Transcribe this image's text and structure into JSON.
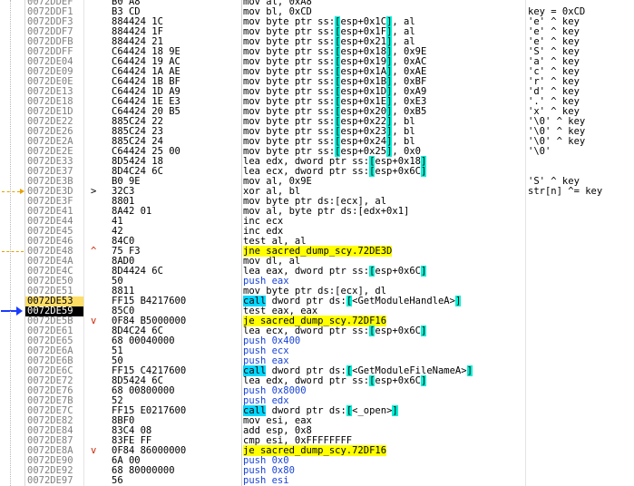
{
  "rows": [
    {
      "addr": "0072DDEF",
      "bytes": "B0 A8",
      "mark": "",
      "parts": [
        {
          "t": "mov al, 0xA8",
          "k": "m"
        }
      ],
      "comment": ""
    },
    {
      "addr": "0072DDF1",
      "bytes": "B3 CD",
      "mark": "",
      "parts": [
        {
          "t": "mov bl, 0xCD",
          "k": "m"
        }
      ],
      "comment": "key = 0xCD"
    },
    {
      "addr": "0072DDF3",
      "bytes": "884424 1C",
      "mark": "",
      "parts": [
        {
          "t": "mov byte ptr ss:",
          "k": "m"
        },
        {
          "t": "[esp+0x1C]",
          "k": "br"
        },
        {
          "t": ", al",
          "k": "m"
        }
      ],
      "comment": "'e' ^ key"
    },
    {
      "addr": "0072DDF7",
      "bytes": "884424 1F",
      "mark": "",
      "parts": [
        {
          "t": "mov byte ptr ss:",
          "k": "m"
        },
        {
          "t": "[esp+0x1F]",
          "k": "br"
        },
        {
          "t": ", al",
          "k": "m"
        }
      ],
      "comment": "'e' ^ key"
    },
    {
      "addr": "0072DDFB",
      "bytes": "884424 21",
      "mark": "",
      "parts": [
        {
          "t": "mov byte ptr ss:",
          "k": "m"
        },
        {
          "t": "[esp+0x21]",
          "k": "br"
        },
        {
          "t": ", al",
          "k": "m"
        }
      ],
      "comment": "'e' ^ key"
    },
    {
      "addr": "0072DDFF",
      "bytes": "C64424 18 9E",
      "mark": "",
      "parts": [
        {
          "t": "mov byte ptr ss:",
          "k": "m"
        },
        {
          "t": "[esp+0x18]",
          "k": "br"
        },
        {
          "t": ", 0x9E",
          "k": "m"
        }
      ],
      "comment": "'S' ^ key"
    },
    {
      "addr": "0072DE04",
      "bytes": "C64424 19 AC",
      "mark": "",
      "parts": [
        {
          "t": "mov byte ptr ss:",
          "k": "m"
        },
        {
          "t": "[esp+0x19]",
          "k": "br"
        },
        {
          "t": ", 0xAC",
          "k": "m"
        }
      ],
      "comment": "'a' ^ key"
    },
    {
      "addr": "0072DE09",
      "bytes": "C64424 1A AE",
      "mark": "",
      "parts": [
        {
          "t": "mov byte ptr ss:",
          "k": "m"
        },
        {
          "t": "[esp+0x1A]",
          "k": "br"
        },
        {
          "t": ", 0xAE",
          "k": "m"
        }
      ],
      "comment": "'c' ^ key"
    },
    {
      "addr": "0072DE0E",
      "bytes": "C64424 1B BF",
      "mark": "",
      "parts": [
        {
          "t": "mov byte ptr ss:",
          "k": "m"
        },
        {
          "t": "[esp+0x1B]",
          "k": "br"
        },
        {
          "t": ", 0xBF",
          "k": "m"
        }
      ],
      "comment": "'r' ^ key"
    },
    {
      "addr": "0072DE13",
      "bytes": "C64424 1D A9",
      "mark": "",
      "parts": [
        {
          "t": "mov byte ptr ss:",
          "k": "m"
        },
        {
          "t": "[esp+0x1D]",
          "k": "br"
        },
        {
          "t": ", 0xA9",
          "k": "m"
        }
      ],
      "comment": "'d' ^ key"
    },
    {
      "addr": "0072DE18",
      "bytes": "C64424 1E E3",
      "mark": "",
      "parts": [
        {
          "t": "mov byte ptr ss:",
          "k": "m"
        },
        {
          "t": "[esp+0x1E]",
          "k": "br"
        },
        {
          "t": ", 0xE3",
          "k": "m"
        }
      ],
      "comment": "'.' ^ key"
    },
    {
      "addr": "0072DE1D",
      "bytes": "C64424 20 B5",
      "mark": "",
      "parts": [
        {
          "t": "mov byte ptr ss:",
          "k": "m"
        },
        {
          "t": "[esp+0x20]",
          "k": "br"
        },
        {
          "t": ", 0xB5",
          "k": "m"
        }
      ],
      "comment": "'x' ^ key"
    },
    {
      "addr": "0072DE22",
      "bytes": "885C24 22",
      "mark": "",
      "parts": [
        {
          "t": "mov byte ptr ss:",
          "k": "m"
        },
        {
          "t": "[esp+0x22]",
          "k": "br"
        },
        {
          "t": ", bl",
          "k": "m"
        }
      ],
      "comment": "'\\0' ^ key"
    },
    {
      "addr": "0072DE26",
      "bytes": "885C24 23",
      "mark": "",
      "parts": [
        {
          "t": "mov byte ptr ss:",
          "k": "m"
        },
        {
          "t": "[esp+0x23]",
          "k": "br"
        },
        {
          "t": ", bl",
          "k": "m"
        }
      ],
      "comment": "'\\0' ^ key"
    },
    {
      "addr": "0072DE2A",
      "bytes": "885C24 24",
      "mark": "",
      "parts": [
        {
          "t": "mov byte ptr ss:",
          "k": "m"
        },
        {
          "t": "[esp+0x24]",
          "k": "br"
        },
        {
          "t": ", bl",
          "k": "m"
        }
      ],
      "comment": "'\\0' ^ key"
    },
    {
      "addr": "0072DE2E",
      "bytes": "C64424 25 00",
      "mark": "",
      "parts": [
        {
          "t": "mov byte ptr ss:",
          "k": "m"
        },
        {
          "t": "[esp+0x25]",
          "k": "br"
        },
        {
          "t": ", 0x0",
          "k": "m"
        }
      ],
      "comment": "'\\0'"
    },
    {
      "addr": "0072DE33",
      "bytes": "8D5424 18",
      "mark": "",
      "parts": [
        {
          "t": "lea edx, dword ptr ss:",
          "k": "m"
        },
        {
          "t": "[esp+0x18]",
          "k": "br"
        }
      ],
      "comment": ""
    },
    {
      "addr": "0072DE37",
      "bytes": "8D4C24 6C",
      "mark": "",
      "parts": [
        {
          "t": "lea ecx, dword ptr ss:",
          "k": "m"
        },
        {
          "t": "[esp+0x6C]",
          "k": "br"
        }
      ],
      "comment": ""
    },
    {
      "addr": "0072DE3B",
      "bytes": "B0 9E",
      "mark": "",
      "parts": [
        {
          "t": "mov al, 0x9E",
          "k": "m"
        }
      ],
      "comment": "'S' ^ key"
    },
    {
      "addr": "0072DE3D",
      "bytes": "32C3",
      "mark": ">",
      "parts": [
        {
          "t": "xor al, bl",
          "k": "m"
        }
      ],
      "comment": "str[n] ^= key"
    },
    {
      "addr": "0072DE3F",
      "bytes": "8801",
      "mark": "",
      "parts": [
        {
          "t": "mov byte ptr ds:",
          "k": "m"
        },
        {
          "t": "[ecx]",
          "k": "m"
        },
        {
          "t": ", al",
          "k": "m"
        }
      ],
      "comment": ""
    },
    {
      "addr": "0072DE41",
      "bytes": "8A42 01",
      "mark": "",
      "parts": [
        {
          "t": "mov al, byte ptr ds:",
          "k": "m"
        },
        {
          "t": "[edx+0x1]",
          "k": "m"
        }
      ],
      "comment": ""
    },
    {
      "addr": "0072DE44",
      "bytes": "41",
      "mark": "",
      "parts": [
        {
          "t": "inc ecx",
          "k": "m"
        }
      ],
      "comment": ""
    },
    {
      "addr": "0072DE45",
      "bytes": "42",
      "mark": "",
      "parts": [
        {
          "t": "inc edx",
          "k": "m"
        }
      ],
      "comment": ""
    },
    {
      "addr": "0072DE46",
      "bytes": "84C0",
      "mark": "",
      "parts": [
        {
          "t": "test al, al",
          "k": "m"
        }
      ],
      "comment": ""
    },
    {
      "addr": "0072DE48",
      "bytes": "75 F3",
      "mark": "^",
      "parts": [
        {
          "t": "jne sacred_dump_scy.72DE3D",
          "k": "jcc"
        }
      ],
      "comment": ""
    },
    {
      "addr": "0072DE4A",
      "bytes": "8AD0",
      "mark": "",
      "parts": [
        {
          "t": "mov dl, al",
          "k": "m"
        }
      ],
      "comment": ""
    },
    {
      "addr": "0072DE4C",
      "bytes": "8D4424 6C",
      "mark": "",
      "parts": [
        {
          "t": "lea eax, dword ptr ss:",
          "k": "m"
        },
        {
          "t": "[esp+0x6C]",
          "k": "br"
        }
      ],
      "comment": ""
    },
    {
      "addr": "0072DE50",
      "bytes": "50",
      "mark": "",
      "parts": [
        {
          "t": "push eax",
          "k": "push"
        }
      ],
      "comment": ""
    },
    {
      "addr": "0072DE51",
      "bytes": "8811",
      "mark": "",
      "parts": [
        {
          "t": "mov byte ptr ds:",
          "k": "m"
        },
        {
          "t": "[ecx]",
          "k": "m"
        },
        {
          "t": ", dl",
          "k": "m"
        }
      ],
      "comment": ""
    },
    {
      "addr": "0072DE53",
      "bytes": "FF15 B4217600",
      "mark": "",
      "parts": [
        {
          "t": "call",
          "k": "call"
        },
        {
          "t": " dword ptr ds:",
          "k": "m"
        },
        {
          "t": "[<GetModuleHandleA>]",
          "k": "br"
        }
      ],
      "comment": "",
      "state": "hl"
    },
    {
      "addr": "0072DE59",
      "bytes": "85C0",
      "mark": "",
      "parts": [
        {
          "t": "test eax, eax",
          "k": "m"
        }
      ],
      "comment": "",
      "state": "cur"
    },
    {
      "addr": "0072DE5B",
      "bytes": "0F84 B5000000",
      "mark": "v",
      "parts": [
        {
          "t": "je sacred_dump_scy.72DF16",
          "k": "jcc"
        }
      ],
      "comment": ""
    },
    {
      "addr": "0072DE61",
      "bytes": "8D4C24 6C",
      "mark": "",
      "parts": [
        {
          "t": "lea ecx, dword ptr ss:",
          "k": "m"
        },
        {
          "t": "[esp+0x6C]",
          "k": "br"
        }
      ],
      "comment": ""
    },
    {
      "addr": "0072DE65",
      "bytes": "68 00040000",
      "mark": "",
      "parts": [
        {
          "t": "push 0x400",
          "k": "push"
        }
      ],
      "comment": ""
    },
    {
      "addr": "0072DE6A",
      "bytes": "51",
      "mark": "",
      "parts": [
        {
          "t": "push ecx",
          "k": "push"
        }
      ],
      "comment": ""
    },
    {
      "addr": "0072DE6B",
      "bytes": "50",
      "mark": "",
      "parts": [
        {
          "t": "push eax",
          "k": "push"
        }
      ],
      "comment": ""
    },
    {
      "addr": "0072DE6C",
      "bytes": "FF15 C4217600",
      "mark": "",
      "parts": [
        {
          "t": "call",
          "k": "call"
        },
        {
          "t": " dword ptr ds:",
          "k": "m"
        },
        {
          "t": "[<GetModuleFileNameA>]",
          "k": "br"
        }
      ],
      "comment": ""
    },
    {
      "addr": "0072DE72",
      "bytes": "8D5424 6C",
      "mark": "",
      "parts": [
        {
          "t": "lea edx, dword ptr ss:",
          "k": "m"
        },
        {
          "t": "[esp+0x6C]",
          "k": "br"
        }
      ],
      "comment": ""
    },
    {
      "addr": "0072DE76",
      "bytes": "68 00800000",
      "mark": "",
      "parts": [
        {
          "t": "push 0x8000",
          "k": "push"
        }
      ],
      "comment": ""
    },
    {
      "addr": "0072DE7B",
      "bytes": "52",
      "mark": "",
      "parts": [
        {
          "t": "push edx",
          "k": "push"
        }
      ],
      "comment": ""
    },
    {
      "addr": "0072DE7C",
      "bytes": "FF15 E0217600",
      "mark": "",
      "parts": [
        {
          "t": "call",
          "k": "call"
        },
        {
          "t": " dword ptr ds:",
          "k": "m"
        },
        {
          "t": "[<_open>]",
          "k": "br"
        }
      ],
      "comment": ""
    },
    {
      "addr": "0072DE82",
      "bytes": "8BF0",
      "mark": "",
      "parts": [
        {
          "t": "mov esi, eax",
          "k": "m"
        }
      ],
      "comment": ""
    },
    {
      "addr": "0072DE84",
      "bytes": "83C4 08",
      "mark": "",
      "parts": [
        {
          "t": "add esp, 0x8",
          "k": "m"
        }
      ],
      "comment": ""
    },
    {
      "addr": "0072DE87",
      "bytes": "83FE FF",
      "mark": "",
      "parts": [
        {
          "t": "cmp esi, 0xFFFFFFFF",
          "k": "m"
        }
      ],
      "comment": ""
    },
    {
      "addr": "0072DE8A",
      "bytes": "0F84 86000000",
      "mark": "v",
      "parts": [
        {
          "t": "je sacred_dump_scy.72DF16",
          "k": "jcc"
        }
      ],
      "comment": ""
    },
    {
      "addr": "0072DE90",
      "bytes": "6A 00",
      "mark": "",
      "parts": [
        {
          "t": "push 0x0",
          "k": "push"
        }
      ],
      "comment": ""
    },
    {
      "addr": "0072DE92",
      "bytes": "68 80000000",
      "mark": "",
      "parts": [
        {
          "t": "push 0x80",
          "k": "push"
        }
      ],
      "comment": ""
    },
    {
      "addr": "0072DE97",
      "bytes": "56",
      "mark": "",
      "parts": [
        {
          "t": "push esi",
          "k": "push"
        }
      ],
      "comment": ""
    }
  ],
  "colors": {
    "call_bg": "#00d8ff",
    "jcc_bg": "#ffff00",
    "push_fg": "#1a44d8",
    "bracket_bg": "#00f0d8",
    "highlight_row": "#ffde66",
    "current_row": "#000000",
    "jump_arrow": "#e8a000",
    "eip_arrow": "#1a3cff"
  },
  "icons": {
    "jump_target": "orange-dashed-arrow-icon",
    "eip": "blue-eip-arrow-icon"
  }
}
